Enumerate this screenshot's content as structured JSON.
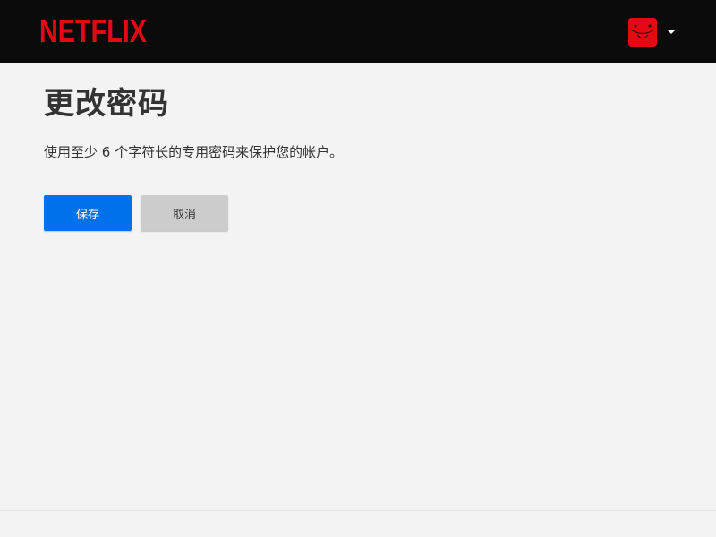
{
  "header": {
    "logo_text": "NETFLIX",
    "brand_color": "#e50914",
    "background_color": "#0b0b0b",
    "avatar_icon": "smiley-profile-icon",
    "menu_icon": "caret-down-icon"
  },
  "main": {
    "title": "更改密码",
    "description": "使用至少 6 个字符长的专用密码来保护您的帐户。",
    "save_label": "保存",
    "cancel_label": "取消",
    "accent_color": "#0071eb"
  }
}
